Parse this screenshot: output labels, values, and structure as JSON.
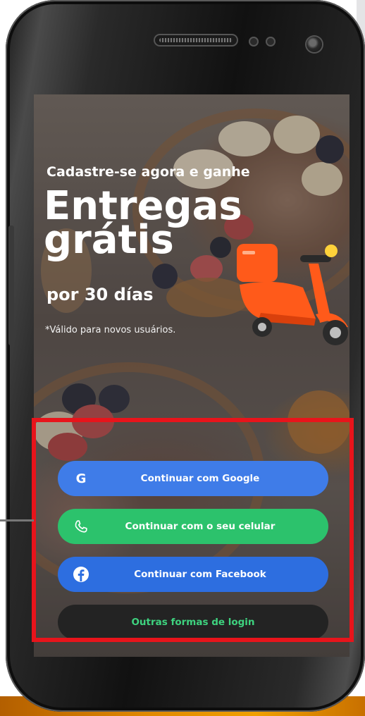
{
  "promo": {
    "headline_small": "Cadastre-se agora e ganhe",
    "headline_big_line1": "Entregas",
    "headline_big_line2": "grátis",
    "duration": "por 30 días",
    "note": "*Válido para novos usuários."
  },
  "login": {
    "google_label": "Continuar com Google",
    "phone_label": "Continuar com o seu celular",
    "facebook_label": "Continuar com Facebook",
    "other_label": "Outras formas de login"
  },
  "icons": {
    "google": "google-icon",
    "phone": "phone-icon",
    "facebook": "facebook-icon",
    "scooter": "scooter-icon"
  },
  "colors": {
    "google_button": "#3f7ce8",
    "phone_button": "#2cc26c",
    "facebook_button": "#2d6ee0",
    "other_button": "#232323",
    "other_text": "#3ed37f",
    "highlight_border": "#e8141b",
    "scooter": "#ff5a1a"
  }
}
